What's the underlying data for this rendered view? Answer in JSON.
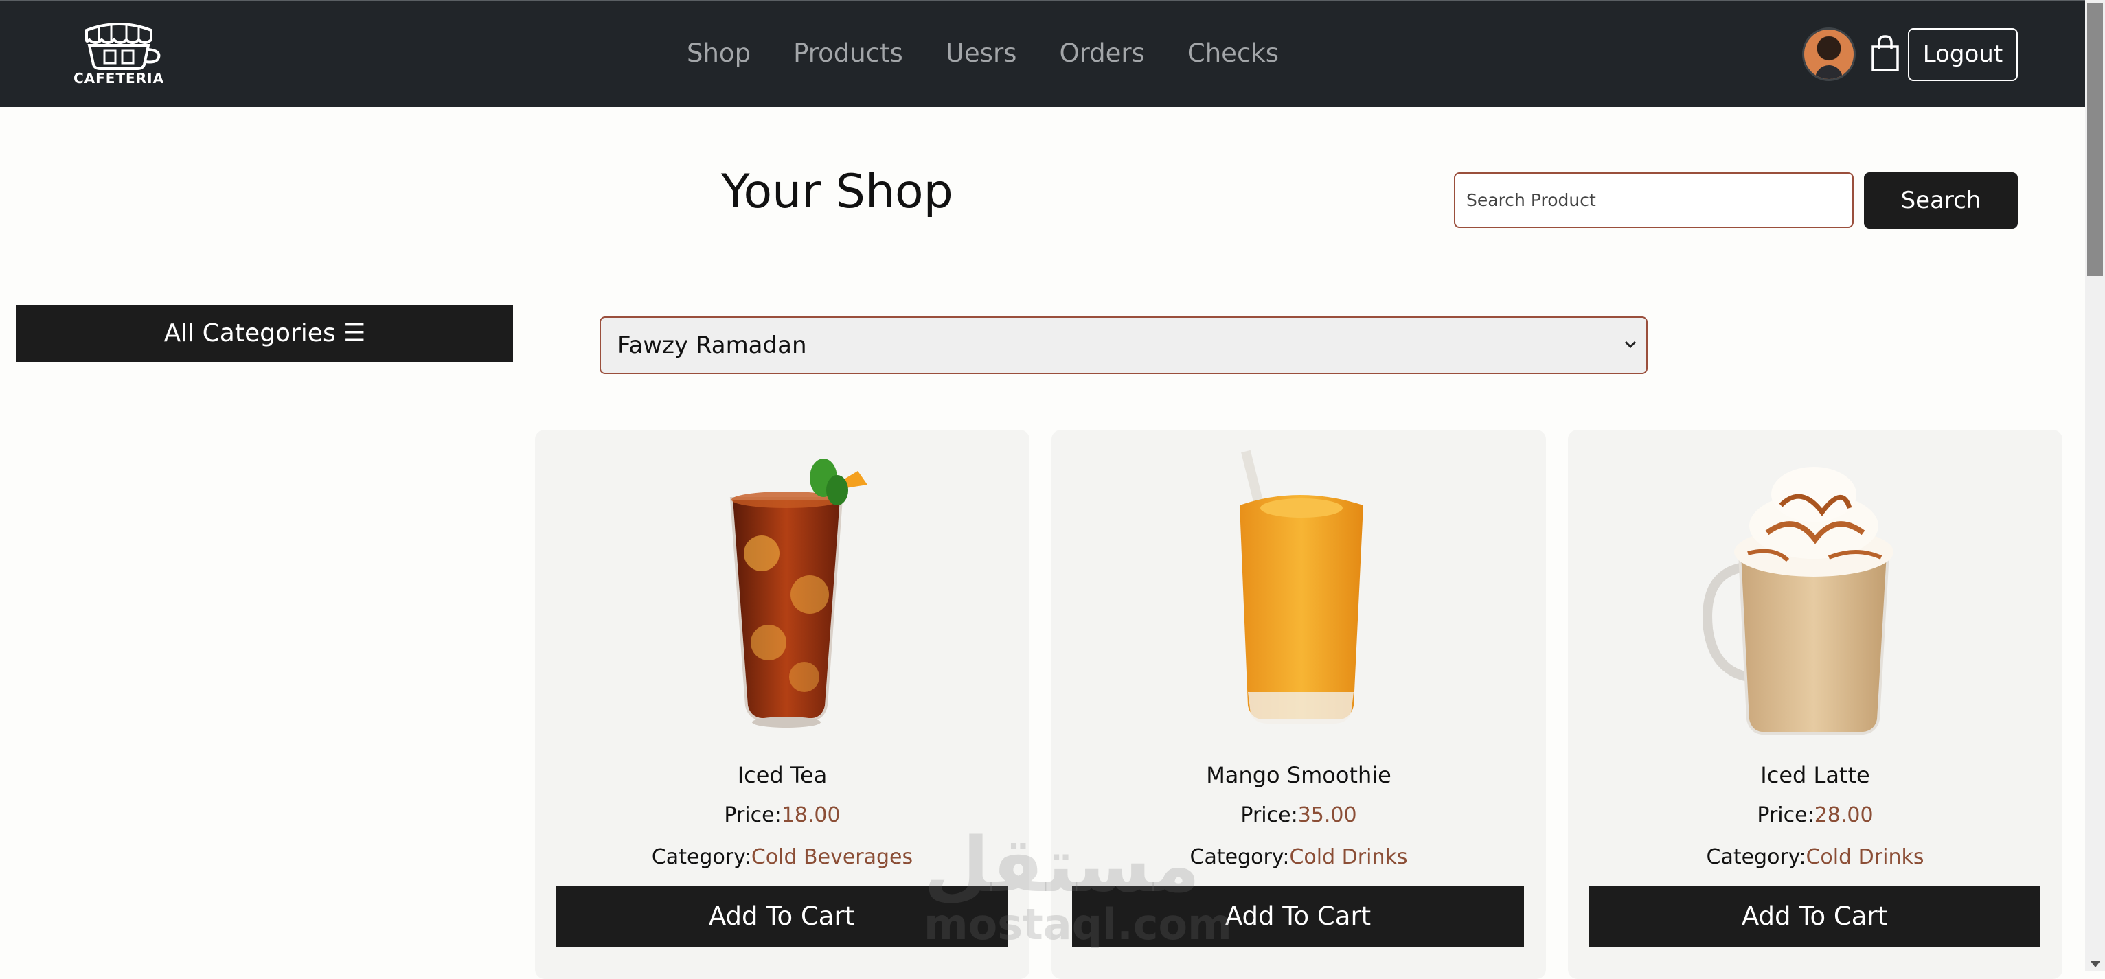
{
  "navbar": {
    "logo_text": "CAFETERIA",
    "links": [
      {
        "label": "Shop"
      },
      {
        "label": "Products"
      },
      {
        "label": "Uesrs"
      },
      {
        "label": "Orders"
      },
      {
        "label": "Checks"
      }
    ],
    "logout_label": "Logout",
    "cart_icon": "shopping-bag-icon",
    "avatar_icon": "user-avatar"
  },
  "header": {
    "title": "Your Shop",
    "search_placeholder": "Search Product",
    "search_button": "Search"
  },
  "sidebar": {
    "categories_label": "All Categories ☰"
  },
  "user_select": {
    "selected": "Fawzy Ramadan"
  },
  "products": [
    {
      "name": "Iced Tea",
      "price_label": "Price:",
      "price": "18.00",
      "category_label": "Category:",
      "category": "Cold Beverages",
      "button": "Add To Cart"
    },
    {
      "name": "Mango Smoothie",
      "price_label": "Price:",
      "price": "35.00",
      "category_label": "Category:",
      "category": "Cold Drinks",
      "button": "Add To Cart"
    },
    {
      "name": "Iced Latte",
      "price_label": "Price:",
      "price": "28.00",
      "category_label": "Category:",
      "category": "Cold Drinks",
      "button": "Add To Cart"
    }
  ],
  "watermark": {
    "arabic": "مستقل",
    "latin": "mostaql.com"
  },
  "colors": {
    "navbar_bg": "#212529",
    "accent": "#8b4e36",
    "button_dark": "#1c1c1c",
    "card_bg": "#f4f4f2",
    "border_accent": "#9a4f3c"
  }
}
